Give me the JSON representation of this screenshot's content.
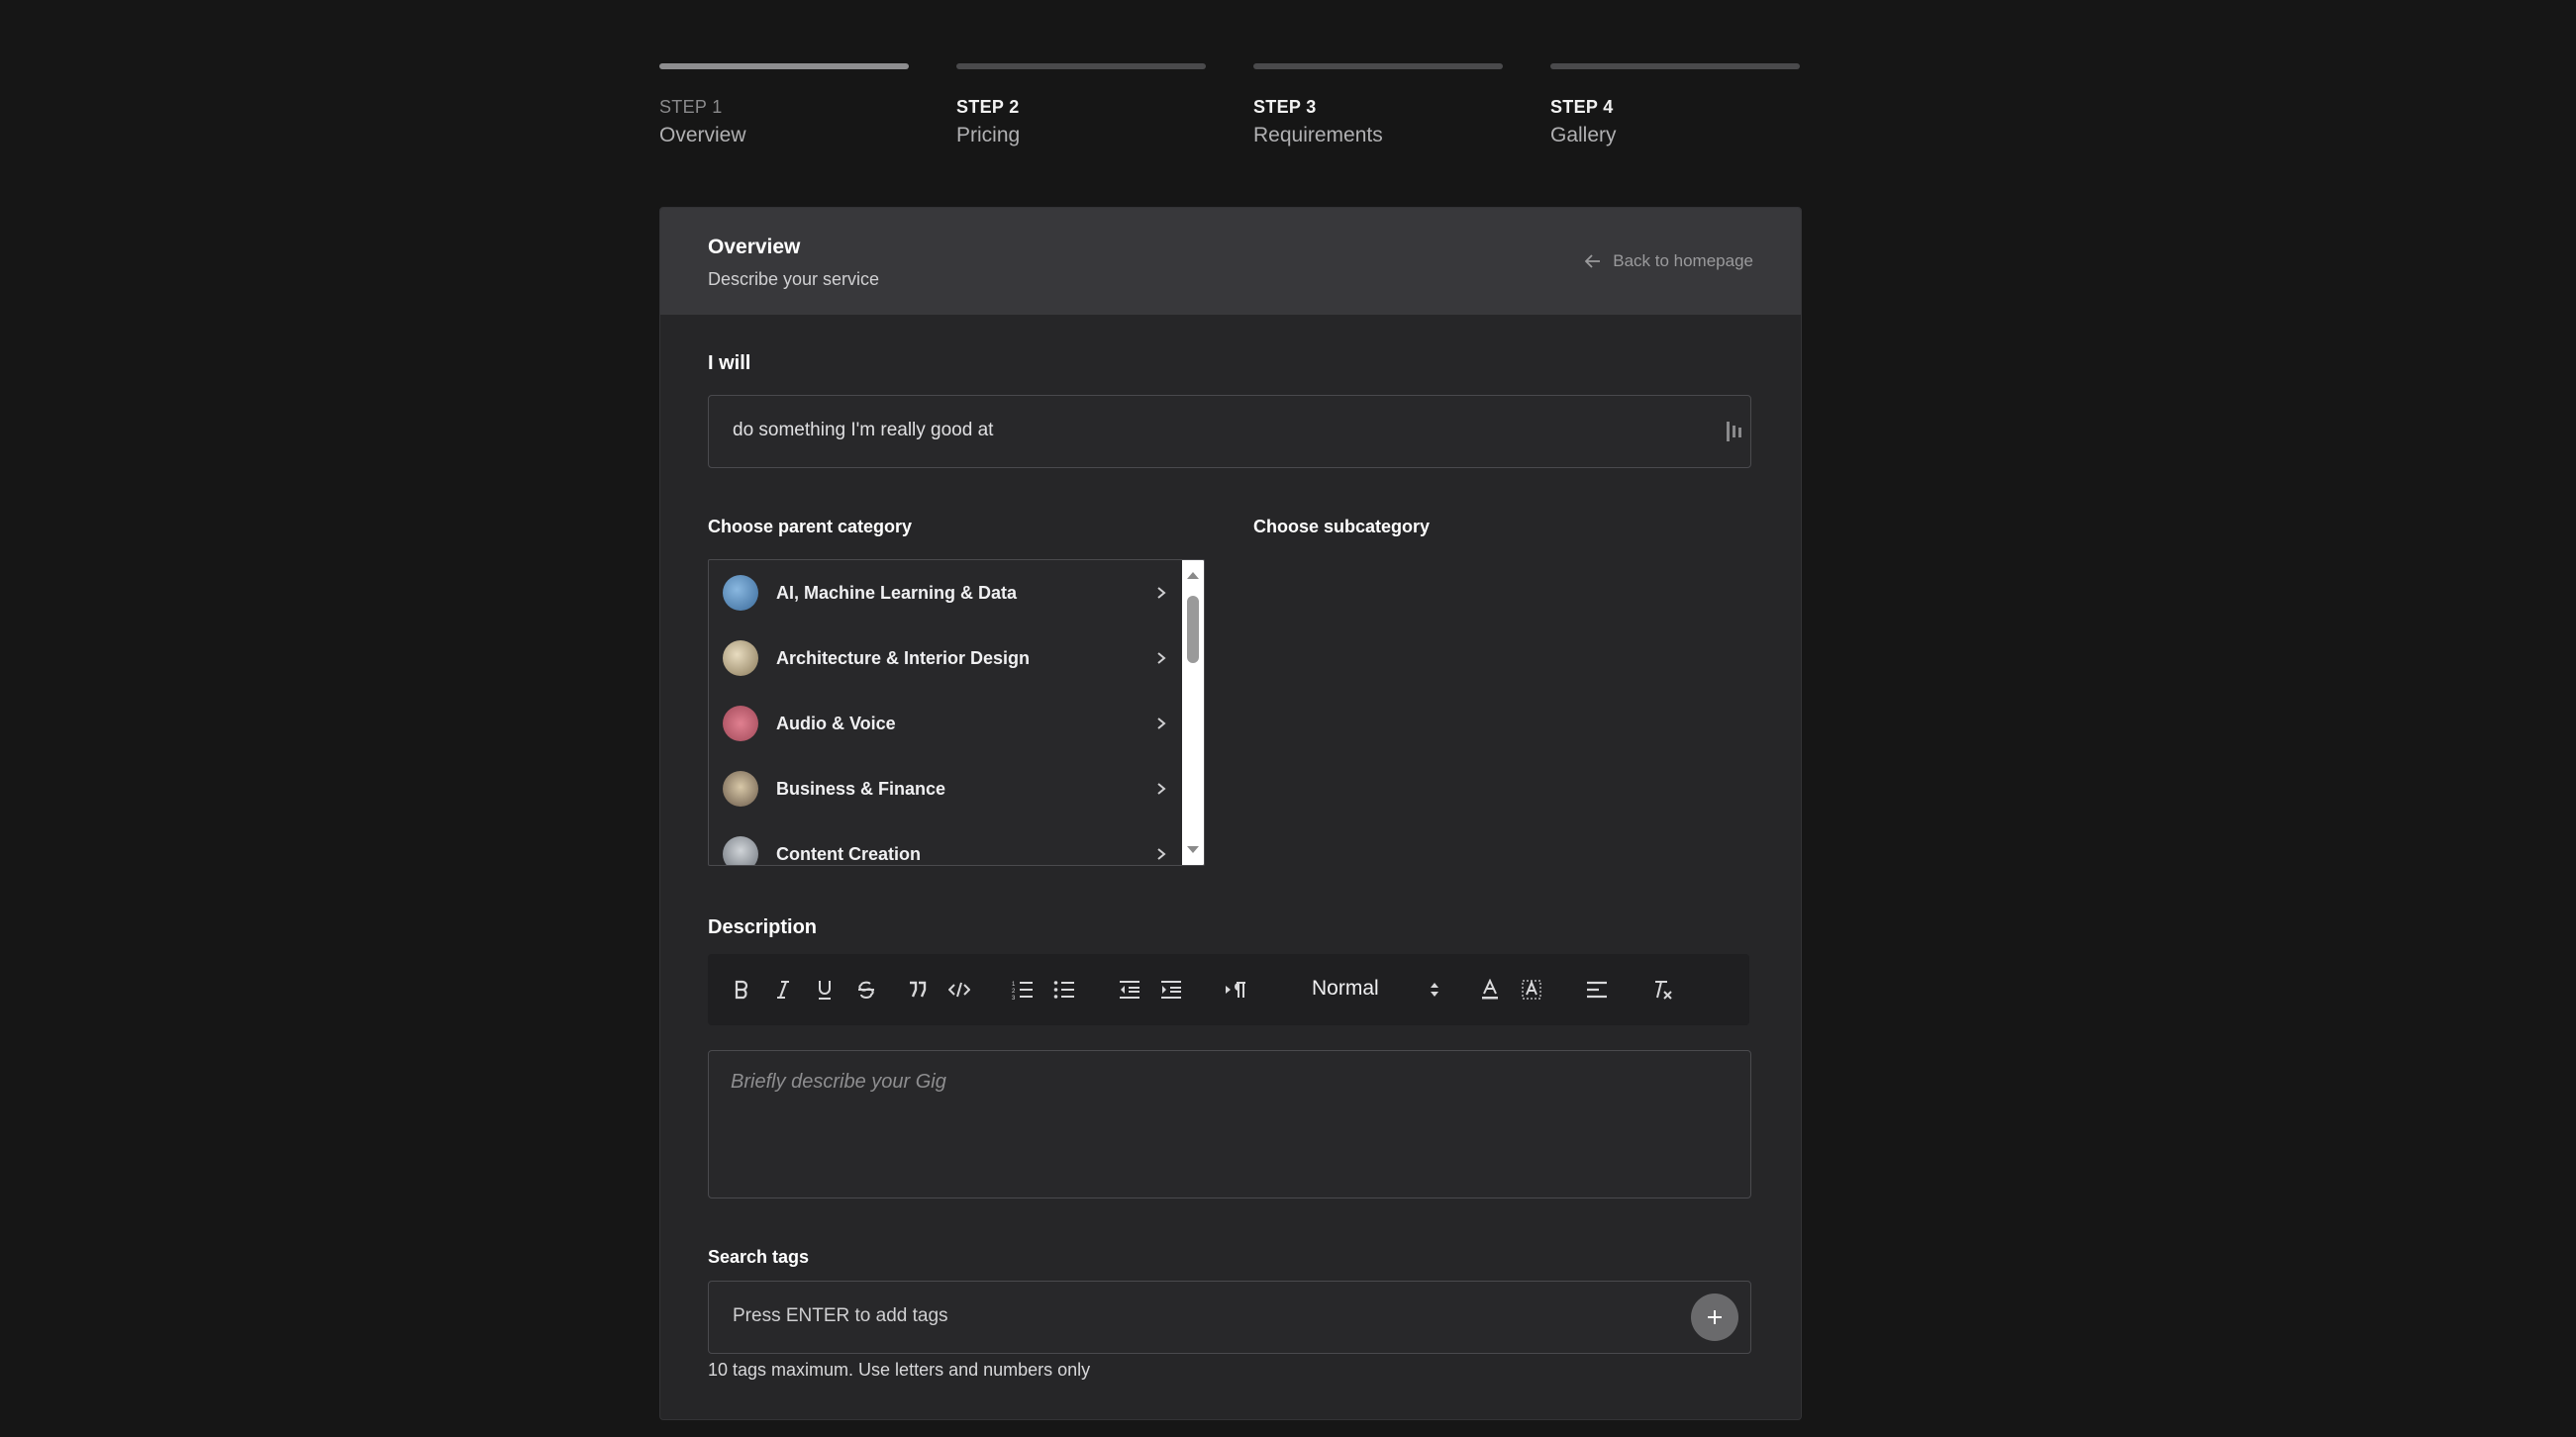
{
  "steps": [
    {
      "num": "STEP 1",
      "name": "Overview"
    },
    {
      "num": "STEP 2",
      "name": "Pricing"
    },
    {
      "num": "STEP 3",
      "name": "Requirements"
    },
    {
      "num": "STEP 4",
      "name": "Gallery"
    }
  ],
  "card": {
    "title": "Overview",
    "subtitle": "Describe your service",
    "back_label": "Back to homepage"
  },
  "title_field": {
    "label": "I will",
    "value": "do something I'm really good at"
  },
  "parent_category": {
    "label": "Choose parent category",
    "items": [
      {
        "label": "AI, Machine Learning & Data",
        "icon": "ai-avatar-icon"
      },
      {
        "label": "Architecture & Interior Design",
        "icon": "architecture-avatar-icon"
      },
      {
        "label": "Audio & Voice",
        "icon": "audio-avatar-icon"
      },
      {
        "label": "Business & Finance",
        "icon": "business-avatar-icon"
      },
      {
        "label": "Content Creation",
        "icon": "content-avatar-icon"
      }
    ]
  },
  "subcategory": {
    "label": "Choose subcategory"
  },
  "description": {
    "label": "Description",
    "format_value": "Normal",
    "placeholder": "Briefly describe your Gig"
  },
  "tags": {
    "label": "Search tags",
    "placeholder": "Press ENTER to add tags",
    "hint": "10 tags maximum. Use letters and numbers only"
  }
}
